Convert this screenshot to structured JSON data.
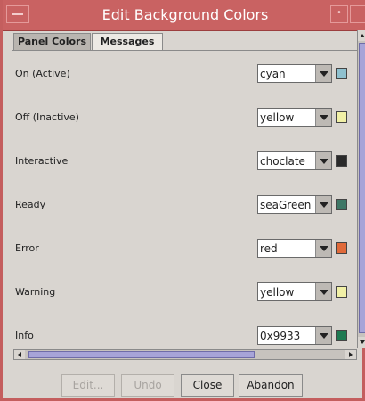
{
  "window": {
    "title": "Edit Background Colors"
  },
  "tabs": [
    {
      "label": "Panel Colors",
      "active": true
    },
    {
      "label": "Messages",
      "active": false
    }
  ],
  "rows": [
    {
      "label": "On (Active)",
      "value": "cyan",
      "swatch": "#8fc1cf"
    },
    {
      "label": "Off (Inactive)",
      "value": "yellow",
      "swatch": "#f1f0a6"
    },
    {
      "label": "Interactive",
      "value": "choclate",
      "swatch": "#2a2a2a"
    },
    {
      "label": "Ready",
      "value": "seaGreen",
      "swatch": "#3e7766"
    },
    {
      "label": "Error",
      "value": "red",
      "swatch": "#e06a3a"
    },
    {
      "label": "Warning",
      "value": "yellow",
      "swatch": "#f1f0a6"
    },
    {
      "label": "Info",
      "value": "0x9933",
      "swatch": "#1e7a52"
    }
  ],
  "buttons": {
    "edit": "Edit...",
    "undo": "Undo",
    "close": "Close",
    "abandon": "Abandon"
  }
}
